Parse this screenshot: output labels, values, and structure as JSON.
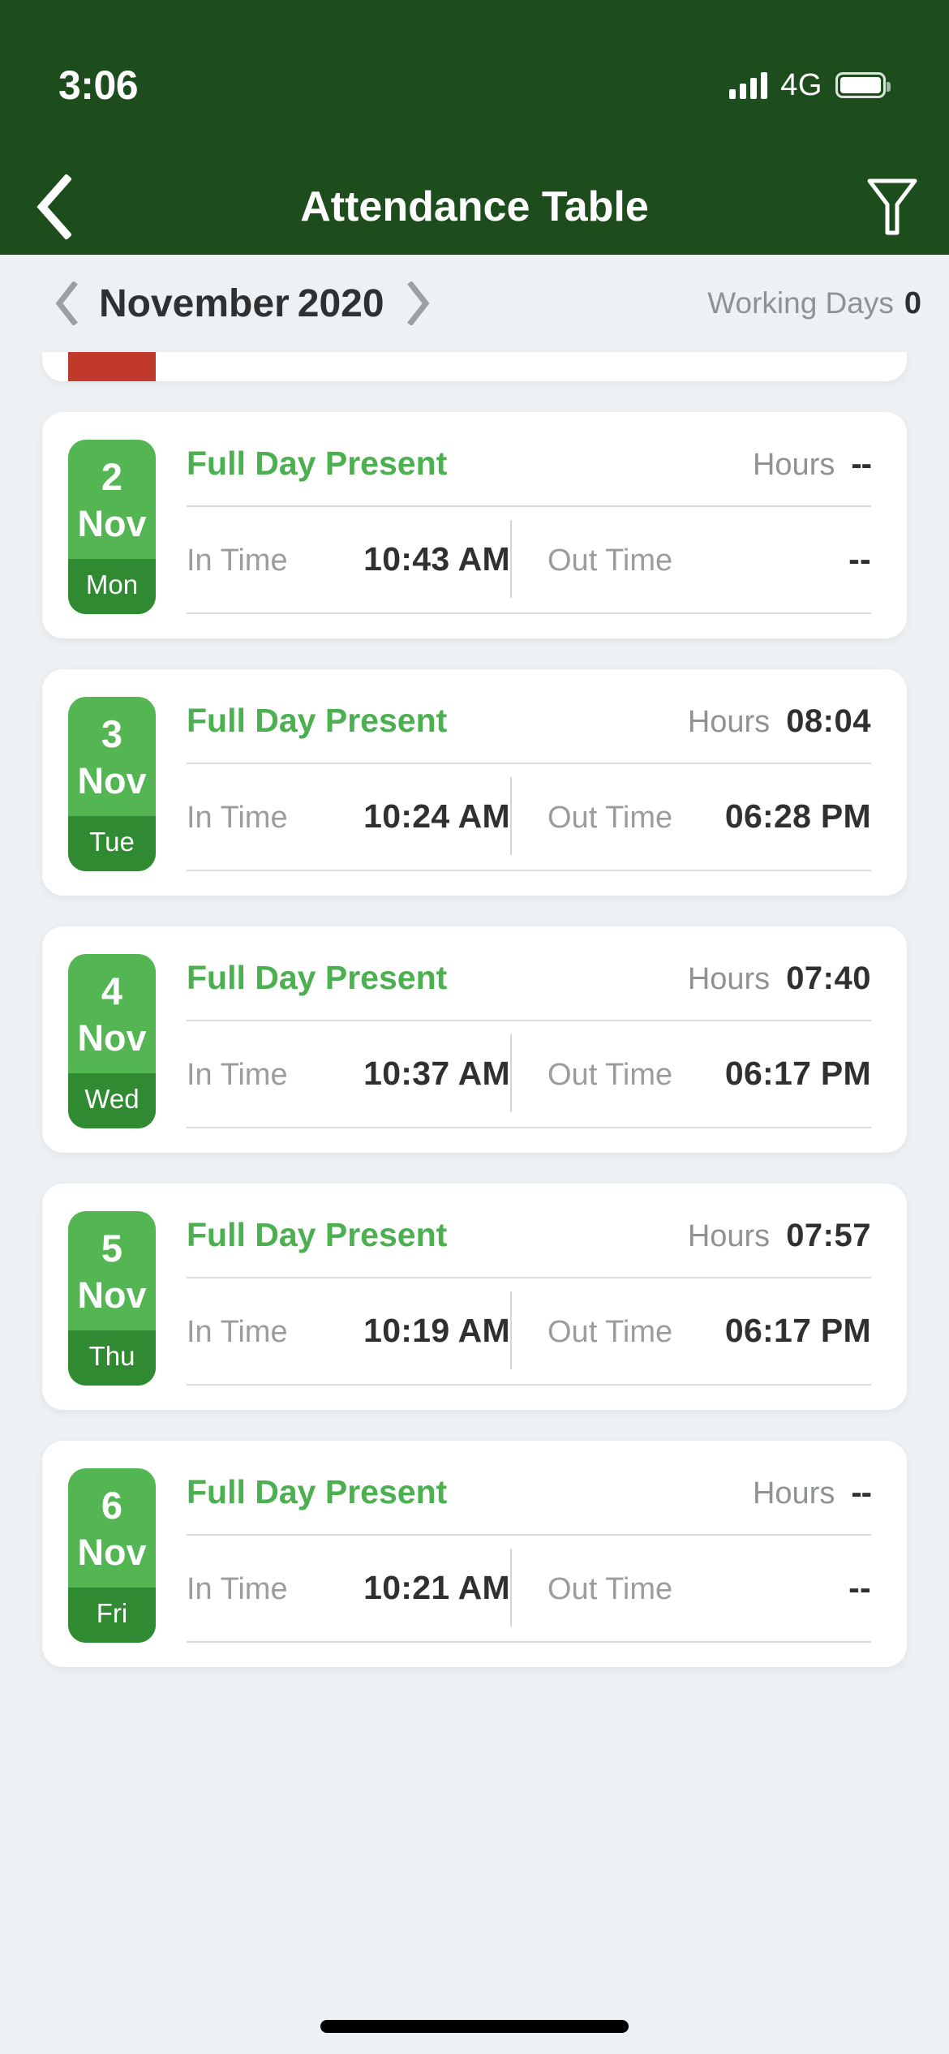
{
  "status_bar": {
    "time": "3:06",
    "network": "4G",
    "signal_icon": "signal-bars-icon",
    "battery_icon": "battery-icon"
  },
  "app_bar": {
    "back_icon": "back-chevron-icon",
    "title": "Attendance Table",
    "filter_icon": "filter-funnel-icon"
  },
  "month_bar": {
    "prev_icon": "chevron-left-icon",
    "month": "November",
    "year": "2020",
    "next_icon": "chevron-right-icon",
    "working_days_label": "Working Days",
    "working_days_value": "0"
  },
  "labels": {
    "in_time": "In Time",
    "out_time": "Out Time",
    "hours": "Hours"
  },
  "colors": {
    "header_green": "#1d4d1d",
    "present_green": "#4caf50",
    "badge_green": "#53b653",
    "badge_green_dark": "#2f8a31",
    "absent_red": "#c0392b",
    "page_background": "#eef1f3"
  },
  "records": [
    {
      "day": "",
      "month": "",
      "weekday": "",
      "status": "",
      "hours": "",
      "in_time": "",
      "out_time": "",
      "clipped": true,
      "absent": true
    },
    {
      "day": "2",
      "month": "Nov",
      "weekday": "Mon",
      "status": "Full Day Present",
      "hours": "--",
      "in_time": "10:43 AM",
      "out_time": "--",
      "clipped": false,
      "absent": false
    },
    {
      "day": "3",
      "month": "Nov",
      "weekday": "Tue",
      "status": "Full Day Present",
      "hours": "08:04",
      "in_time": "10:24 AM",
      "out_time": "06:28 PM",
      "clipped": false,
      "absent": false
    },
    {
      "day": "4",
      "month": "Nov",
      "weekday": "Wed",
      "status": "Full Day Present",
      "hours": "07:40",
      "in_time": "10:37 AM",
      "out_time": "06:17 PM",
      "clipped": false,
      "absent": false
    },
    {
      "day": "5",
      "month": "Nov",
      "weekday": "Thu",
      "status": "Full Day Present",
      "hours": "07:57",
      "in_time": "10:19 AM",
      "out_time": "06:17 PM",
      "clipped": false,
      "absent": false
    },
    {
      "day": "6",
      "month": "Nov",
      "weekday": "Fri",
      "status": "Full Day Present",
      "hours": "--",
      "in_time": "10:21 AM",
      "out_time": "--",
      "clipped": false,
      "absent": false
    }
  ]
}
